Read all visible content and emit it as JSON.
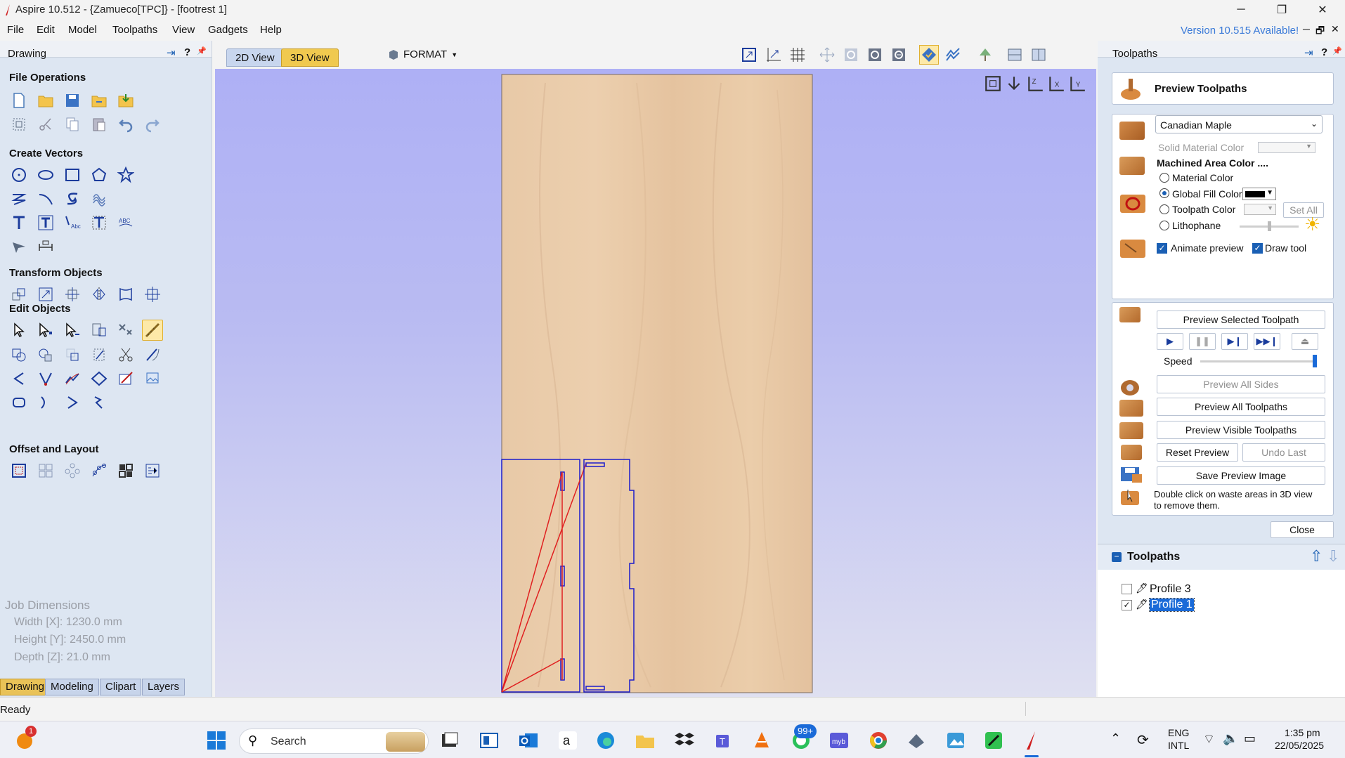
{
  "window": {
    "title": "Aspire 10.512 - {Zamueco[TPC]} - [footrest 1]",
    "minimize": "─",
    "maximize": "❐",
    "close": "✕"
  },
  "menu": {
    "items": [
      "File",
      "Edit",
      "Model",
      "Toolpaths",
      "View",
      "Gadgets",
      "Help"
    ],
    "version_notice": "Version 10.515 Available!",
    "mdi": [
      "─",
      "🗗",
      "✕"
    ]
  },
  "left_panel": {
    "title": "Drawing",
    "header_buttons": [
      "⇥",
      "?",
      "📌"
    ],
    "sections": {
      "file_operations": "File Operations",
      "create_vectors": "Create Vectors",
      "transform_objects": "Transform Objects",
      "edit_objects": "Edit Objects",
      "offset_layout": "Offset and Layout"
    },
    "job": {
      "title": "Job Dimensions",
      "width": "Width  [X]: 1230.0 mm",
      "height": "Height [Y]: 2450.0 mm",
      "depth": "Depth  [Z]: 21.0 mm"
    },
    "tabs": [
      "Drawing",
      "Modeling",
      "Clipart",
      "Layers"
    ]
  },
  "center": {
    "tabs": [
      "2D View",
      "3D View"
    ],
    "format_label": "FORMAT"
  },
  "right_panel": {
    "title": "Toolpaths",
    "header_buttons": [
      "⇥",
      "?",
      "📌"
    ],
    "preview_title": "Preview Toolpaths",
    "material": "Canadian Maple",
    "solid_material_color": "Solid Material Color",
    "machined_area_title": "Machined Area Color ....",
    "radio_options": [
      "Material Color",
      "Global Fill Color",
      "Toolpath Color",
      "Lithophane"
    ],
    "selected_radio": "Global Fill Color",
    "set_all": "Set All",
    "animate_preview": "Animate preview",
    "draw_tool": "Draw tool",
    "preview_selected": "Preview Selected Toolpath",
    "speed_label": "Speed",
    "speed_level": 0.98,
    "preview_all_sides": "Preview All Sides",
    "preview_all_toolpaths": "Preview All Toolpaths",
    "preview_visible_toolpaths": "Preview Visible Toolpaths",
    "reset_preview": "Reset Preview",
    "undo_last": "Undo Last",
    "save_preview_image": "Save Preview Image",
    "hint_line1": "Double click on waste areas in 3D view",
    "hint_line2": "to remove them.",
    "close": "Close",
    "toolpaths_list_title": "Toolpaths",
    "toolpaths": [
      {
        "name": "Profile 3",
        "checked": false,
        "selected": false
      },
      {
        "name": "Profile 1",
        "checked": true,
        "selected": true
      }
    ]
  },
  "status": {
    "text": "Ready"
  },
  "taskbar": {
    "search_placeholder": "Search",
    "badge_top": "1",
    "whatsapp_badge": "99+",
    "lang_line1": "ENG",
    "lang_line2": "INTL",
    "time": "1:35 pm",
    "date": "22/05/2025"
  },
  "colors": {
    "accent_tab": "#f0c94f",
    "link": "#3a7ad8",
    "vector_blue": "#1c1ccc",
    "toolpath_red": "#e02020"
  }
}
